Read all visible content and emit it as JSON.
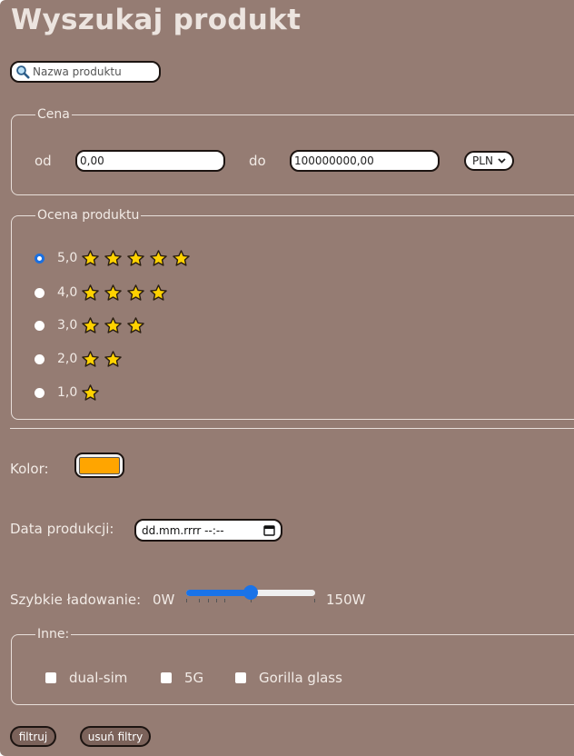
{
  "page": {
    "title": "Wyszukaj produkt",
    "background_color": "#957c73"
  },
  "search": {
    "placeholder": "Nazwa produktu",
    "icon": "magnifier-icon"
  },
  "price": {
    "legend": "Cena",
    "from_label": "od",
    "from_value": "0,00",
    "to_label": "do",
    "to_value": "100000000,00",
    "currency": "PLN",
    "currency_icon": "chevron-down-icon"
  },
  "rating": {
    "legend": "Ocena produktu",
    "options": [
      {
        "value": "5,0",
        "stars": 5,
        "checked": true
      },
      {
        "value": "4,0",
        "stars": 4,
        "checked": false
      },
      {
        "value": "3,0",
        "stars": 3,
        "checked": false
      },
      {
        "value": "2,0",
        "stars": 2,
        "checked": false
      },
      {
        "value": "1,0",
        "stars": 1,
        "checked": false
      }
    ],
    "star_color": "#ffd200",
    "radio_accent": "#1a6fe0"
  },
  "color": {
    "label": "Kolor:",
    "value": "#ffa500"
  },
  "date": {
    "label": "Data produkcji:",
    "placeholder": "dd.mm.rrrr --:--",
    "icon": "calendar-icon"
  },
  "charging": {
    "label": "Szybkie ładowanie:",
    "min_label": "0W",
    "max_label": "150W",
    "min": 0,
    "max": 150,
    "value": 75,
    "ticks": [
      0,
      15,
      25,
      35,
      45,
      75,
      150
    ],
    "accent": "#1a73e8"
  },
  "other": {
    "legend": "Inne:",
    "options": [
      {
        "label": "dual-sim",
        "checked": false
      },
      {
        "label": "5G",
        "checked": false
      },
      {
        "label": "Gorilla glass",
        "checked": false
      }
    ]
  },
  "actions": {
    "filter_label": "filtruj",
    "clear_label": "usuń filtry",
    "button_color": "#7b625a"
  }
}
